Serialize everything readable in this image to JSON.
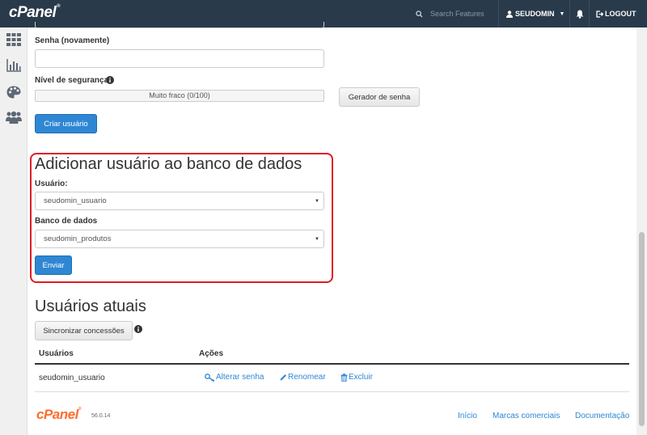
{
  "header": {
    "logo_text": "cPanel",
    "search_placeholder": "Search Features",
    "username": "SEUDOMIN",
    "logout_label": "LOGOUT"
  },
  "sidebar": {
    "items": [
      {
        "icon": "grid-icon"
      },
      {
        "icon": "stats-chart-icon"
      },
      {
        "icon": "palette-icon"
      },
      {
        "icon": "users-icon"
      }
    ]
  },
  "create_user_form": {
    "password_again_label": "Senha (novamente)",
    "password_again_value": "",
    "security_level_label": "Nível de segurança",
    "strength_text": "Muito fraco (0/100)",
    "strength_value_percent": 0,
    "generator_button": "Gerador de senha",
    "create_button": "Criar usuário"
  },
  "add_user_to_db": {
    "title": "Adicionar usuário ao banco de dados",
    "user_label": "Usuário:",
    "user_selected": "seudomin_usuario",
    "database_label": "Banco de dados",
    "database_selected": "seudomin_produtos",
    "submit_button": "Enviar"
  },
  "current_users": {
    "title": "Usuários atuais",
    "sync_button": "Sincronizar concessões",
    "columns": [
      "Usuários",
      "Ações"
    ],
    "rows": [
      {
        "user": "seudomin_usuario",
        "actions": [
          "Alterar senha",
          "Renomear",
          "Excluir"
        ]
      }
    ]
  },
  "footer": {
    "logo_text": "cPanel",
    "version": "56.0.14",
    "links": [
      "Início",
      "Marcas comerciais",
      "Documentação"
    ]
  },
  "colors": {
    "topbar": "#293a4a",
    "primary": "#2f87d4",
    "highlight": "#e01b24",
    "brand_orange": "#ff6c2c"
  }
}
